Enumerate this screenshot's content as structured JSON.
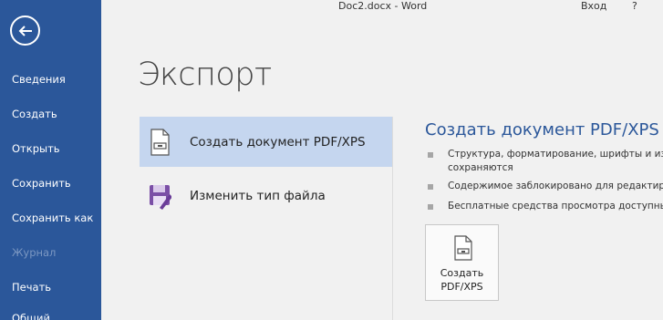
{
  "window": {
    "title": "Doc2.docx - Word",
    "signin": "Вход",
    "help": "?"
  },
  "sidebar": {
    "items": [
      {
        "label": "Сведения",
        "enabled": true
      },
      {
        "label": "Создать",
        "enabled": true
      },
      {
        "label": "Открыть",
        "enabled": true
      },
      {
        "label": "Сохранить",
        "enabled": true
      },
      {
        "label": "Сохранить как",
        "enabled": true
      },
      {
        "label": "Журнал",
        "enabled": false
      },
      {
        "label": "Печать",
        "enabled": true
      },
      {
        "label": "Общий",
        "enabled": true
      }
    ]
  },
  "main": {
    "title": "Экспорт",
    "options": [
      {
        "label": "Создать документ PDF/XPS",
        "icon": "pdf-document-icon",
        "selected": true
      },
      {
        "label": "Изменить тип файла",
        "icon": "save-as-type-icon",
        "selected": false
      }
    ]
  },
  "panel": {
    "title": "Создать документ PDF/XPS",
    "bullets": [
      {
        "line1": "Структура, форматирование, шрифты и из",
        "line2": "сохраняются"
      },
      {
        "line1": "Содержимое заблокировано для редактир"
      },
      {
        "line1": "Бесплатные средства просмотра доступны"
      }
    ],
    "button": {
      "line1": "Создать",
      "line2": "PDF/XPS",
      "icon": "pdf-document-icon"
    }
  },
  "colors": {
    "accent": "#2b579a",
    "selected": "#c5d6ef",
    "background": "#f1f1f1"
  }
}
